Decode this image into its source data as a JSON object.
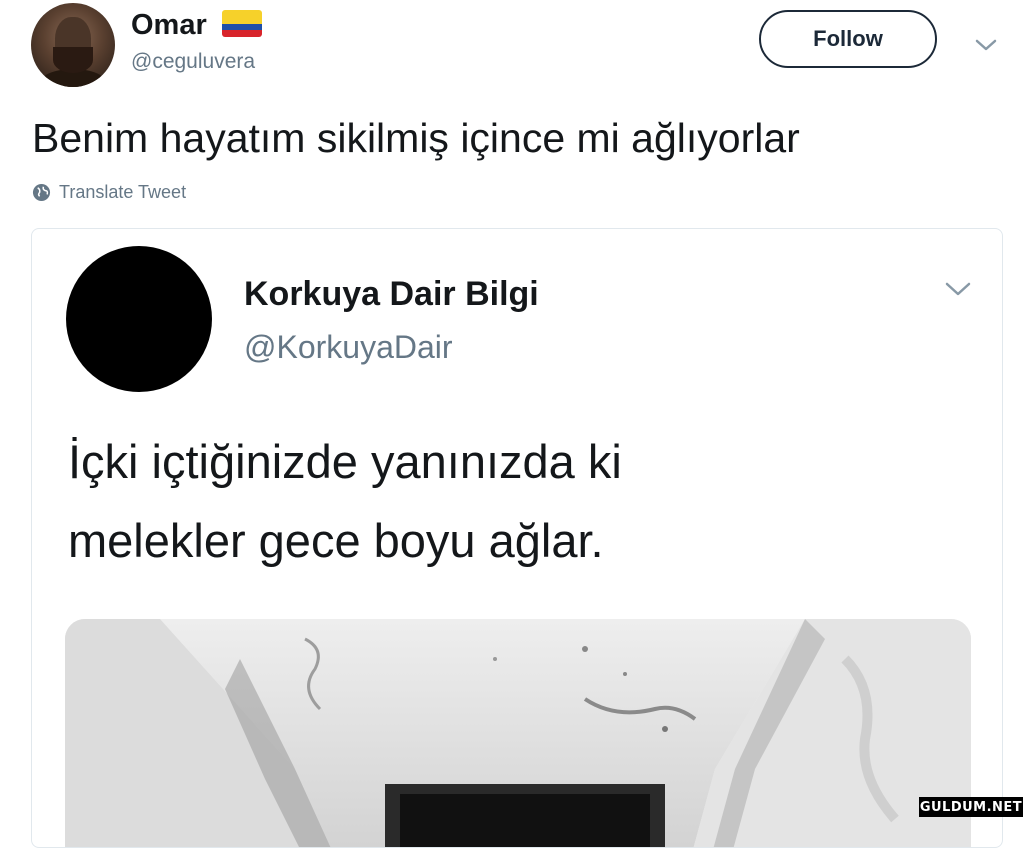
{
  "author": {
    "name": "Omar",
    "handle": "@ceguluvera",
    "flag_icon": "colombia-flag-icon"
  },
  "actions": {
    "follow_label": "Follow"
  },
  "tweet": {
    "text": "Benim hayatım sikilmiş içince mi ağlıyorlar",
    "translate_label": "Translate Tweet"
  },
  "quoted": {
    "name": "Korkuya Dair Bilgi",
    "handle": "@KorkuyaDair",
    "text_line1": "İçki içtiğinizde yanınızda ki",
    "text_line2": "melekler gece boyu ağlar."
  },
  "watermark": {
    "text": "GULDUM.NET"
  },
  "colors": {
    "primary_text": "#14171a",
    "secondary_text": "#657786",
    "border": "#e1e8ed",
    "button_border": "#1c2938"
  }
}
